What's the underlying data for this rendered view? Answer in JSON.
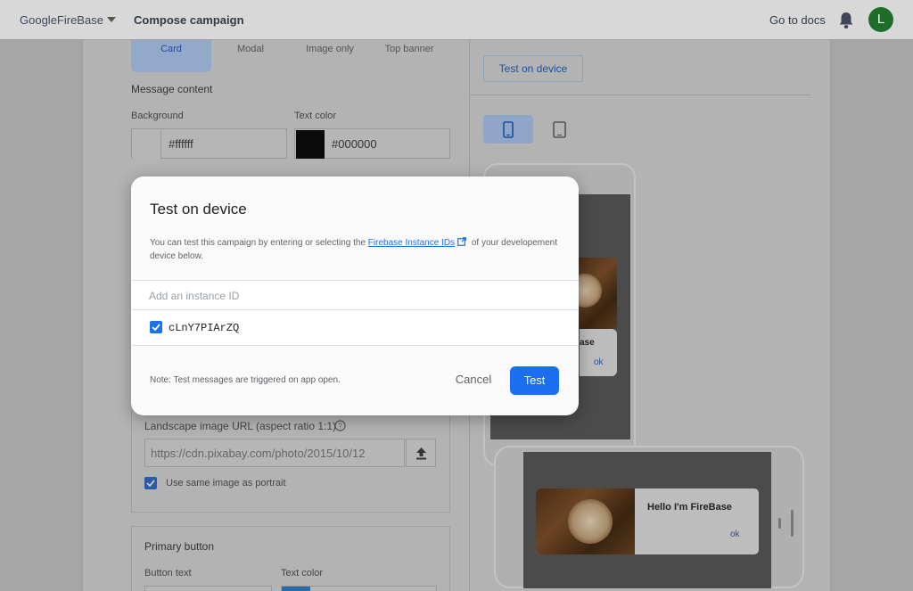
{
  "topbar": {
    "app_name": "GoogleFireBase",
    "page_title": "Compose campaign",
    "docs_link": "Go to docs",
    "avatar_letter": "L",
    "avatar_color": "#1e6e2a"
  },
  "layout_tabs": [
    {
      "label": "Card",
      "active": true
    },
    {
      "label": "Modal",
      "active": false
    },
    {
      "label": "Image only",
      "active": false
    },
    {
      "label": "Top banner",
      "active": false
    }
  ],
  "message_content": {
    "heading": "Message content",
    "background_label": "Background",
    "background_value": "#ffffff",
    "text_color_label": "Text color",
    "text_color_value": "#000000"
  },
  "landscape": {
    "label": "Landscape image URL (aspect ratio 1:1)",
    "url_value": "https://cdn.pixabay.com/photo/2015/10/12",
    "same_image_label": "Use same image as portrait",
    "same_image_checked": true
  },
  "primary_button": {
    "heading": "Primary button",
    "button_text_label": "Button text",
    "text_color_label": "Text color"
  },
  "preview": {
    "test_on_device_label": "Test on device",
    "portrait_card_title": "ase",
    "portrait_card_button": "ok",
    "landscape_card_title": "Hello I'm FireBase",
    "landscape_card_button": "ok"
  },
  "modal": {
    "title": "Test on device",
    "desc_before": "You can test this campaign by entering or selecting the ",
    "desc_link": "Firebase Instance IDs",
    "desc_after": " of your developement device below.",
    "instance_placeholder": "Add an instance ID",
    "instance_ids": [
      {
        "id": "cLnY7PIArZQ",
        "checked": true
      }
    ],
    "note": "Note: Test messages are triggered on app open.",
    "cancel_label": "Cancel",
    "test_label": "Test",
    "accent_color": "#1a6ef0"
  }
}
